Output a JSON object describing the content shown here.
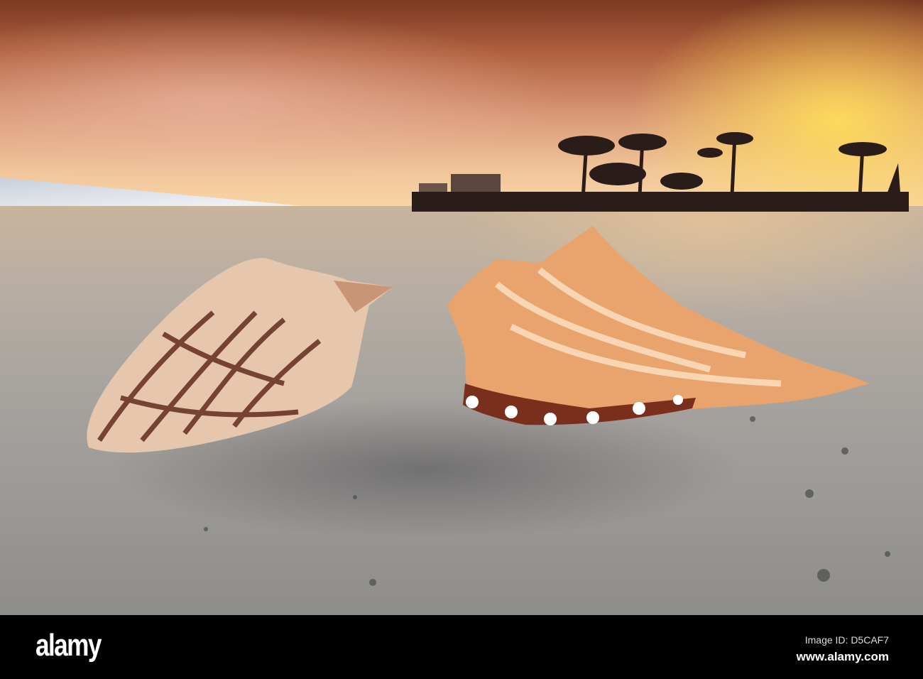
{
  "photo": {
    "subject": "Two seashells on sandy beach at sunset",
    "colors": {
      "sky_top": "#7a3a22",
      "sun_glow": "#ffdc5a",
      "sand": "#a7a39f"
    }
  },
  "footer": {
    "logo": "alamy",
    "image_id": "Image ID: D5CAF7",
    "url": "www.alamy.com"
  }
}
